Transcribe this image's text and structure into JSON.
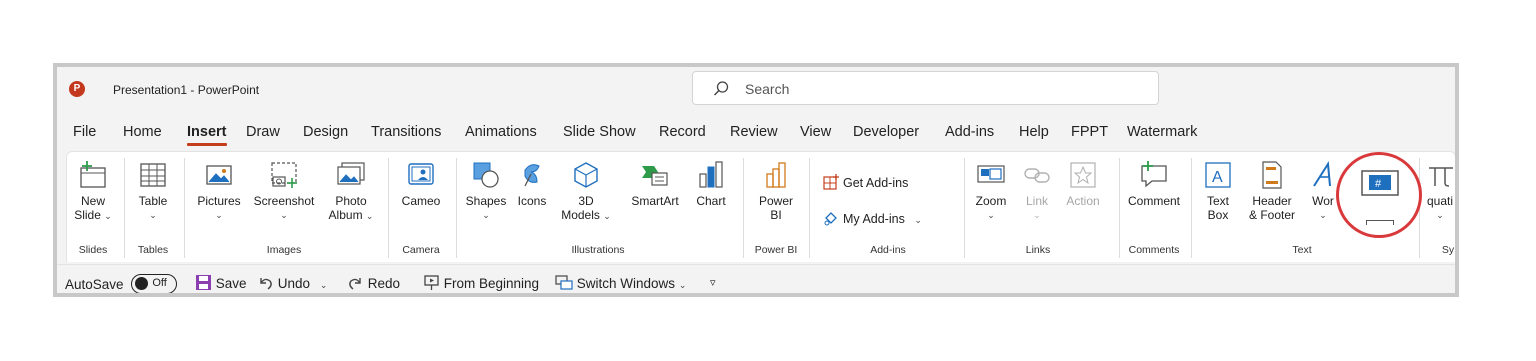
{
  "window": {
    "title": "Presentation1  -  PowerPoint",
    "app_logo": "P",
    "search_placeholder": "Search"
  },
  "tabs": [
    {
      "label": "File"
    },
    {
      "label": "Home"
    },
    {
      "label": "Insert",
      "active": true
    },
    {
      "label": "Draw"
    },
    {
      "label": "Design"
    },
    {
      "label": "Transitions"
    },
    {
      "label": "Animations"
    },
    {
      "label": "Slide Show"
    },
    {
      "label": "Record"
    },
    {
      "label": "Review"
    },
    {
      "label": "View"
    },
    {
      "label": "Developer"
    },
    {
      "label": "Add-ins"
    },
    {
      "label": "Help"
    },
    {
      "label": "FPPT"
    },
    {
      "label": "Watermark"
    }
  ],
  "ribbon": {
    "slides": {
      "new_slide_1": "New",
      "new_slide_2": "Slide",
      "group": "Slides"
    },
    "tables": {
      "table": "Table",
      "group": "Tables"
    },
    "images": {
      "pictures": "Pictures",
      "screenshot": "Screenshot",
      "photo_1": "Photo",
      "photo_2": "Album",
      "group": "Images"
    },
    "camera": {
      "cameo": "Cameo",
      "group": "Camera"
    },
    "illustrations": {
      "shapes": "Shapes",
      "icons": "Icons",
      "models_1": "3D",
      "models_2": "Models",
      "smartart": "SmartArt",
      "chart": "Chart",
      "group": "Illustrations"
    },
    "powerbi": {
      "label_1": "Power",
      "label_2": "BI",
      "group": "Power BI"
    },
    "addins": {
      "get": "Get Add-ins",
      "my": "My Add-ins",
      "group": "Add-ins"
    },
    "links": {
      "zoom": "Zoom",
      "link": "Link",
      "action": "Action",
      "group": "Links"
    },
    "comments": {
      "comment": "Comment",
      "group": "Comments"
    },
    "text": {
      "textbox_1": "Text",
      "textbox_2": "Box",
      "header_1": "Header",
      "header_2": "& Footer",
      "wordart": "Wor",
      "group": "Text"
    },
    "symbols": {
      "equation": "quati",
      "group": "Sy"
    }
  },
  "qat": {
    "autosave": "AutoSave",
    "toggle_state": "Off",
    "save": "Save",
    "undo": "Undo",
    "redo": "Redo",
    "from_beginning": "From Beginning",
    "switch_windows": "Switch Windows"
  },
  "colors": {
    "accent": "#c43e1c",
    "icon_blue": "#1f6fbf",
    "icon_green": "#2e9b4b",
    "icon_orange": "#d07a1a",
    "highlight": "#d9393b"
  }
}
